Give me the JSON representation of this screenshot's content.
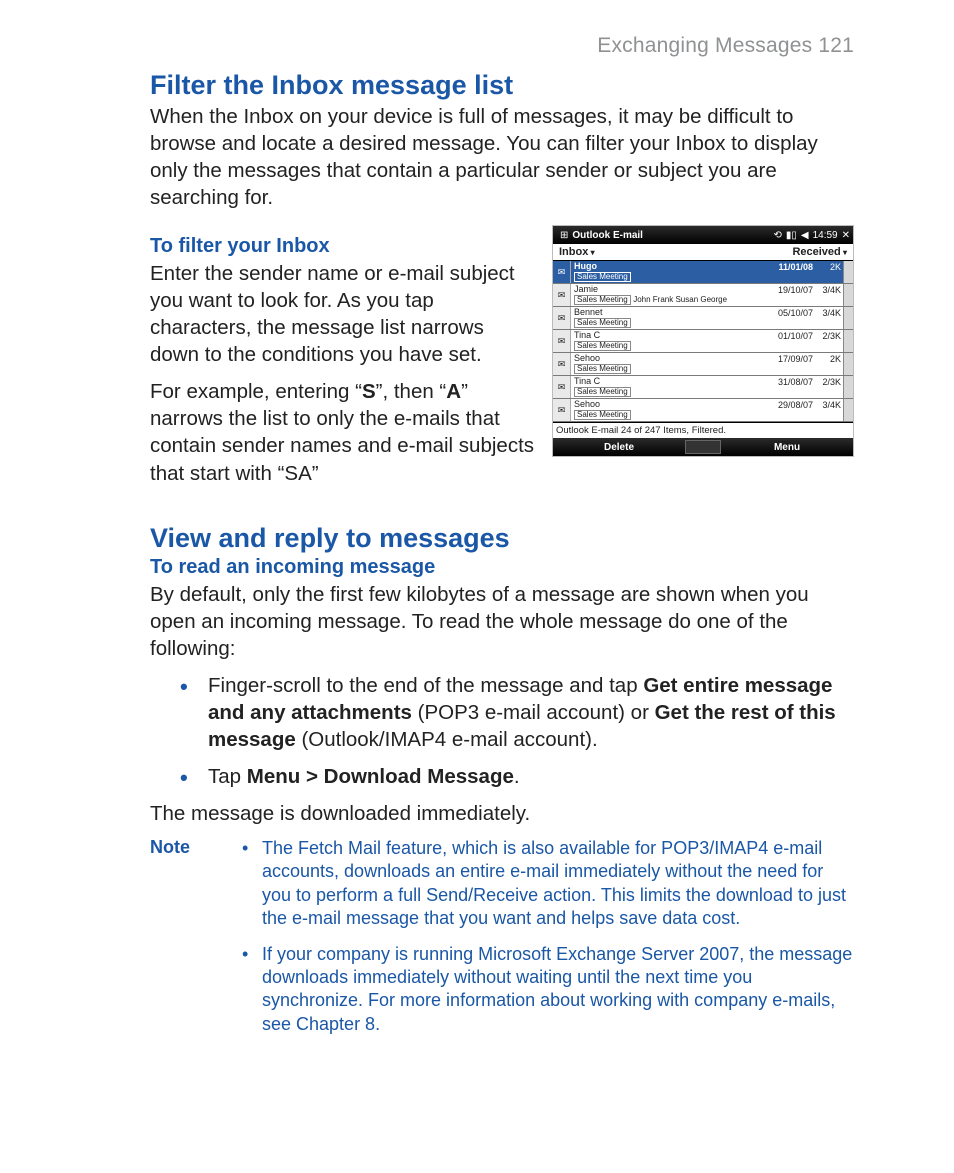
{
  "header": {
    "running": "Exchanging Messages  121"
  },
  "s1": {
    "title": "Filter the Inbox message list",
    "intro": "When the Inbox on your device is full of messages, it may be difficult to browse and locate a desired message. You can filter your Inbox to display only the messages that contain a particular sender or subject you are searching for.",
    "sub": "To filter your Inbox",
    "p1": "Enter the sender name or e-mail subject you want to look for. As you tap characters, the message list narrows down to the conditions you have set.",
    "p2a": "For example, entering “",
    "p2b": "”, then “",
    "p2c": "” narrows the list to only the e-mails that contain sender names and e-mail subjects that start with “SA”",
    "bold_s": "S",
    "bold_a": "A"
  },
  "shot": {
    "title": "Outlook E-mail",
    "time": "14:59",
    "left": "Inbox",
    "right": "Received",
    "rows": [
      {
        "name": "Hugo",
        "sub": "Sales Meeting",
        "extra": "",
        "date": "11/01/08",
        "size": "2K"
      },
      {
        "name": "Jamie",
        "sub": "Sales Meeting",
        "extra": "John Frank Susan George",
        "date": "19/10/07",
        "size": "3/4K"
      },
      {
        "name": "Bennet",
        "sub": "Sales Meeting",
        "extra": "",
        "date": "05/10/07",
        "size": "3/4K"
      },
      {
        "name": "Tina C",
        "sub": "Sales Meeting",
        "extra": "",
        "date": "01/10/07",
        "size": "2/3K"
      },
      {
        "name": "Sehoo",
        "sub": "Sales Meeting",
        "extra": "",
        "date": "17/09/07",
        "size": "2K"
      },
      {
        "name": "Tina C",
        "sub": "Sales Meeting",
        "extra": "",
        "date": "31/08/07",
        "size": "2/3K"
      },
      {
        "name": "Sehoo",
        "sub": "Sales Meeting",
        "extra": "",
        "date": "29/08/07",
        "size": "3/4K"
      }
    ],
    "status": "Outlook E-mail  24 of 247 Items, Filtered.",
    "sk_left": "Delete",
    "sk_right": "Menu"
  },
  "s2": {
    "title": "View and reply to messages",
    "sub": "To read an incoming message",
    "intro": "By default, only the first few kilobytes of a message are shown when you open an incoming message. To read the whole message do one of the following:",
    "b1_a": "Finger-scroll to the end of the message and tap ",
    "b1_bold1": "Get entire message and any attachments",
    "b1_b": " (POP3 e-mail account) or ",
    "b1_bold2": "Get the rest of this message",
    "b1_c": "  (Outlook/IMAP4 e-mail account).",
    "b2_a": "Tap ",
    "b2_bold": "Menu > Download Message",
    "b2_b": ".",
    "after": "The message is downloaded immediately.",
    "note_label": "Note",
    "note1": "The Fetch Mail feature, which is also available for POP3/IMAP4 e-mail accounts, downloads an entire e-mail immediately without the need for you to perform a full Send/Receive action. This limits the download to just the e-mail message that you want and helps save data cost.",
    "note2": "If your company is running Microsoft Exchange Server 2007, the message downloads immediately without waiting until the next time you synchronize. For more information about working with company e-mails, see Chapter 8."
  }
}
